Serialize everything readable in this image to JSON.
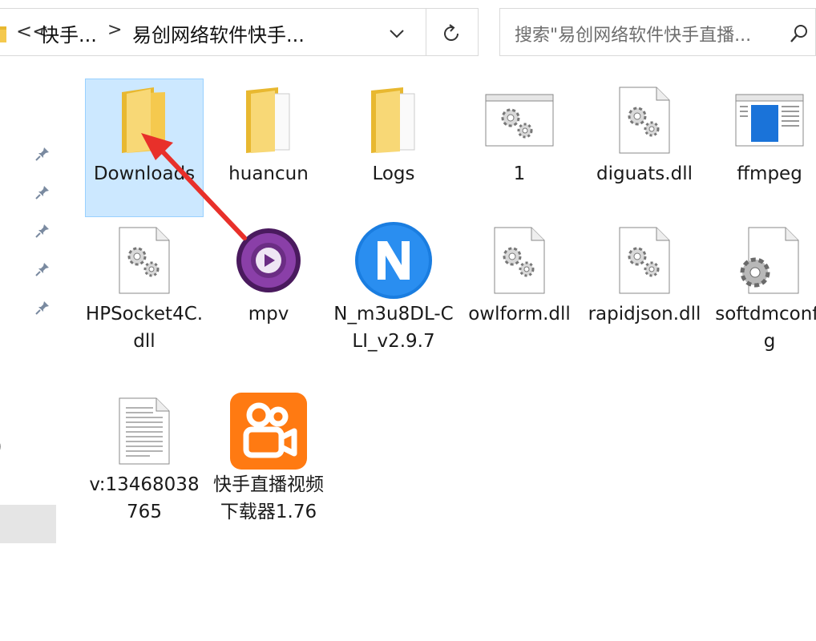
{
  "address_bar": {
    "overflow_chevron": "<<",
    "crumbs": [
      "快手...",
      "易创网络软件快手..."
    ],
    "separator": ">"
  },
  "search": {
    "placeholder": "搜索\"易创网络软件快手直播..."
  },
  "files": [
    {
      "label": "Downloads",
      "type": "folder",
      "selected": true
    },
    {
      "label": "huancun",
      "type": "folder"
    },
    {
      "label": "Logs",
      "type": "folder"
    },
    {
      "label": "1",
      "type": "app-window"
    },
    {
      "label": "diguats.dll",
      "type": "dll"
    },
    {
      "label": "ffmpeg",
      "type": "exe-window"
    },
    {
      "label": "HPSocket4C.dll",
      "type": "dll"
    },
    {
      "label": "mpv",
      "type": "mpv-app"
    },
    {
      "label": "N_m3u8DL-CLI_v2.9.7",
      "type": "n-app"
    },
    {
      "label": "owlform.dll",
      "type": "dll"
    },
    {
      "label": "rapidjson.dll",
      "type": "dll"
    },
    {
      "label": "softdmconfig",
      "type": "config"
    },
    {
      "label": "v:13468038765",
      "type": "text"
    },
    {
      "label": "快手直播视频下载器1.76",
      "type": "kuaishou-app"
    }
  ],
  "nav": {
    "partial_glyph": ")"
  },
  "colors": {
    "selection_fill": "#cce8ff",
    "selection_border": "#99d1ff",
    "arrow": "#e8302a",
    "folder": "#f5c94e",
    "kuaishou_orange": "#ff7a12",
    "n_blue": "#1a7de0",
    "mpv_purple": "#6b2d84"
  }
}
